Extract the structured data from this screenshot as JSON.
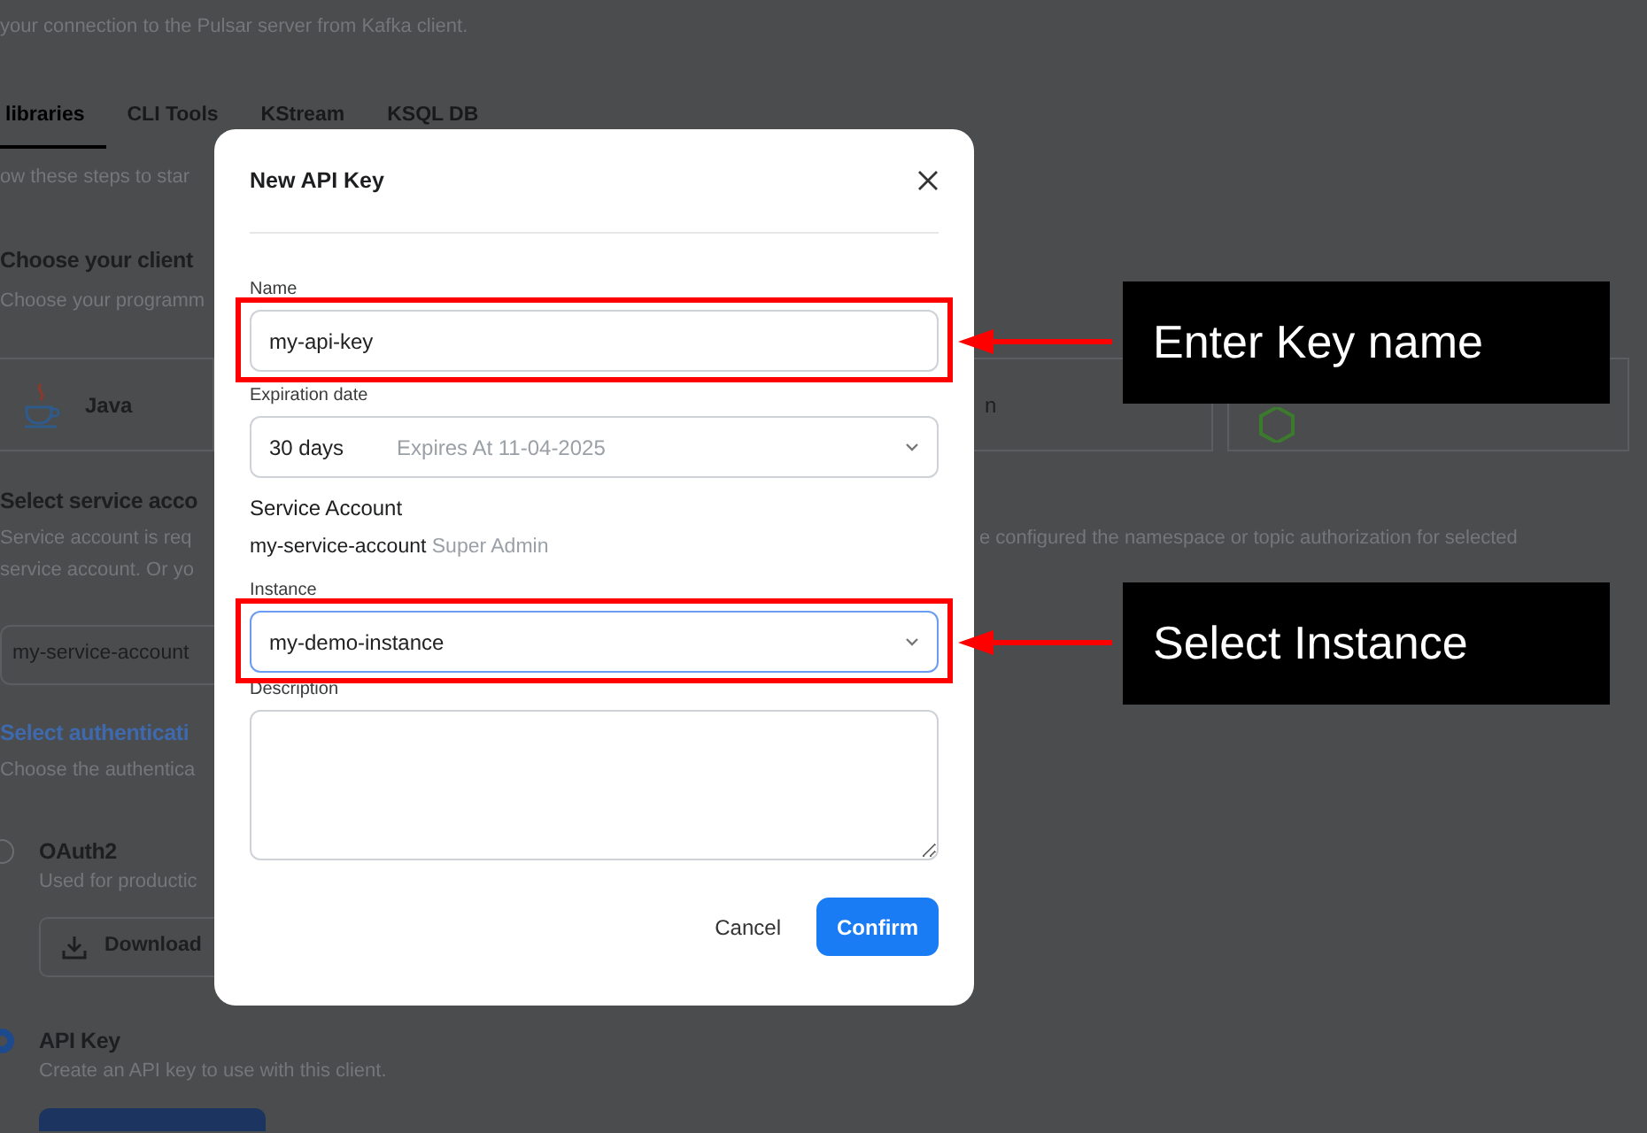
{
  "page": {
    "subtitle": "your connection to the Pulsar server from Kafka client.",
    "tabs": [
      {
        "label": "libraries",
        "selected": true
      },
      {
        "label": "CLI Tools",
        "selected": false
      },
      {
        "label": "KStream",
        "selected": false
      },
      {
        "label": "KSQL DB",
        "selected": false
      }
    ],
    "intro": "ow these steps to star",
    "client_section": {
      "heading": "Choose your client",
      "text": "Choose your programm",
      "cards": [
        {
          "kind": "java",
          "label": "Java"
        },
        {
          "kind": "plain",
          "label": "n"
        },
        {
          "kind": "node"
        }
      ]
    },
    "service_section": {
      "heading": "Select service acco",
      "text_lines": [
        "Service account is req",
        "service account. Or yo"
      ],
      "text_right": "e configured the namespace or topic authorization for selected",
      "dropdown": {
        "value": "my-service-account"
      }
    },
    "auth_section": {
      "heading": "Select authenticati",
      "text": "Choose the authentica",
      "options": [
        {
          "label": "OAuth2",
          "description": "Used for productic",
          "selected": false,
          "button": "Download"
        },
        {
          "label": "API Key",
          "description": "Create an API key to use with this client.",
          "selected": true,
          "action_button": true
        }
      ]
    }
  },
  "modal": {
    "title": "New API Key",
    "fields": [
      {
        "kind": "text",
        "label": "Name",
        "value": "my-api-key",
        "focused": false,
        "callout": "Enter Key name"
      },
      {
        "kind": "select",
        "label": "Expiration date",
        "value": "30 days",
        "hint": "Expires At 11-04-2025",
        "focused": false
      },
      {
        "kind": "info",
        "label": "Service Account",
        "value": "my-service-account",
        "hint": "Super Admin"
      },
      {
        "kind": "select",
        "label": "Instance",
        "value": "my-demo-instance",
        "focused": true,
        "callout": "Select Instance"
      },
      {
        "kind": "textarea",
        "label": "Description"
      }
    ],
    "buttons": [
      {
        "kind": "secondary",
        "label": "Cancel"
      },
      {
        "kind": "primary",
        "label": "Confirm"
      }
    ]
  }
}
